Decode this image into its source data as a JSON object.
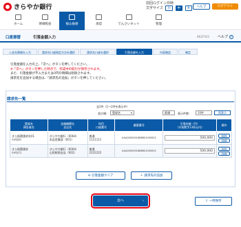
{
  "bank": {
    "name": "きらやか銀行"
  },
  "util": {
    "last_login": "前回ログイン日時",
    "font_size_label": "文字サイズ",
    "font_small": "小",
    "font_medium": "中",
    "font_large": "大",
    "help": "ヘルプ",
    "logout": "ログアウト"
  },
  "gnav": {
    "items": [
      {
        "label": "ホーム"
      },
      {
        "label": "明細照会"
      },
      {
        "label": "振込振替"
      },
      {
        "label": "承認"
      },
      {
        "label": "でんさいネット"
      },
      {
        "label": "管理"
      }
    ]
  },
  "page": {
    "breadcrumb": "口座振替",
    "title": "引落金額入力",
    "code": "BKZF003",
    "help": "ヘルプ"
  },
  "steps": [
    "入金先情報を入力",
    "請求先口座指定方法を選択",
    "請求先口座を選択",
    "引落金額を入力",
    "内容確認",
    "確定"
  ],
  "notes": {
    "line1": "引落金額を入力の上、「次へ」ボタンを押してください。",
    "line2": "※「次へ」ボタンを押した時点で、作成中の取引が保存されます。",
    "line3": "また、引落金額が不入力または0円の明細は削除されます。",
    "line4": "請求先を追加する場合は、「請求先の追加」ボタンを押してください。"
  },
  "panel": {
    "title": "請求先一覧",
    "count": "全2件（1～2件を表示中）",
    "sort_label": "並び順：",
    "sort_value": "登録名",
    "order_value": "昇順",
    "per_page_label": "表示件数：",
    "per_page_value": "10件",
    "reorder": "再表示"
  },
  "table": {
    "headers": [
      "登録名\n預金者名",
      "金融機関名\n支店名",
      "科目\n口座番号",
      "顧客番号",
      "引落金額（円）\n（半角数字13桁以内）",
      "操作"
    ],
    "rows": [
      {
        "name": "きら振替請求先01",
        "kana": "ｷﾗﾔｶﾀﾛｳ",
        "bank": "きらやか銀行（0064）",
        "branch": "本店営業部（001）",
        "type": "普通",
        "acct": "1111111",
        "cust": "AAA0000001888801000001",
        "amount": "500,000",
        "op1": "削除",
        "op2": "詳細"
      },
      {
        "name": "きら振替請求",
        "kana": "ｷﾗﾔｶﾊﾅｺ",
        "bank": "きらやか銀行（0064）",
        "branch": "山形駅前支店（002）",
        "type": "普通",
        "acct": "2222222",
        "cust": "AAA0000001888801000002",
        "amount": "500,000",
        "op1": "削除",
        "op2": "詳細"
      }
    ]
  },
  "buttons": {
    "clear": "引落金額クリア",
    "add": "請求先の追加",
    "next": "次へ",
    "save": "一時保存"
  },
  "colors": {
    "brand": "#0b5aa7",
    "accent": "#e60012"
  }
}
